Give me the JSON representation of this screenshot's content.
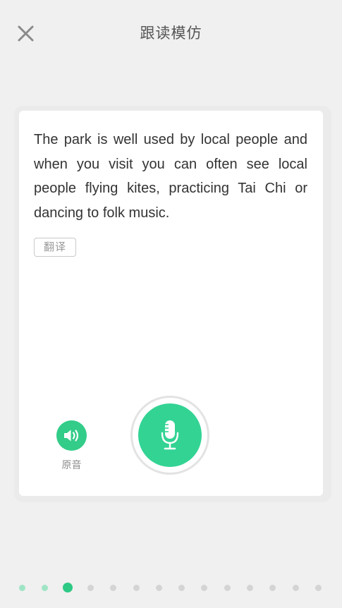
{
  "header": {
    "title": "跟读模仿",
    "close_icon": "close-icon"
  },
  "card": {
    "sentence": "The park is well used by local people and when you visit you can often see local people flying kites, practicing Tai Chi or dancing to folk music.",
    "translate_label": "翻译",
    "original_audio_label": "原音",
    "speaker_icon": "speaker-icon",
    "mic_icon": "microphone-icon"
  },
  "pagination": {
    "total": 14,
    "current_index": 3,
    "completed": [
      1,
      2
    ]
  },
  "colors": {
    "accent": "#33d394",
    "background": "#f0f0f0",
    "card": "#ffffff",
    "dot_done": "#9fe4c5",
    "dot_active": "#2ec985",
    "dot_inactive": "#d4d4d4"
  }
}
